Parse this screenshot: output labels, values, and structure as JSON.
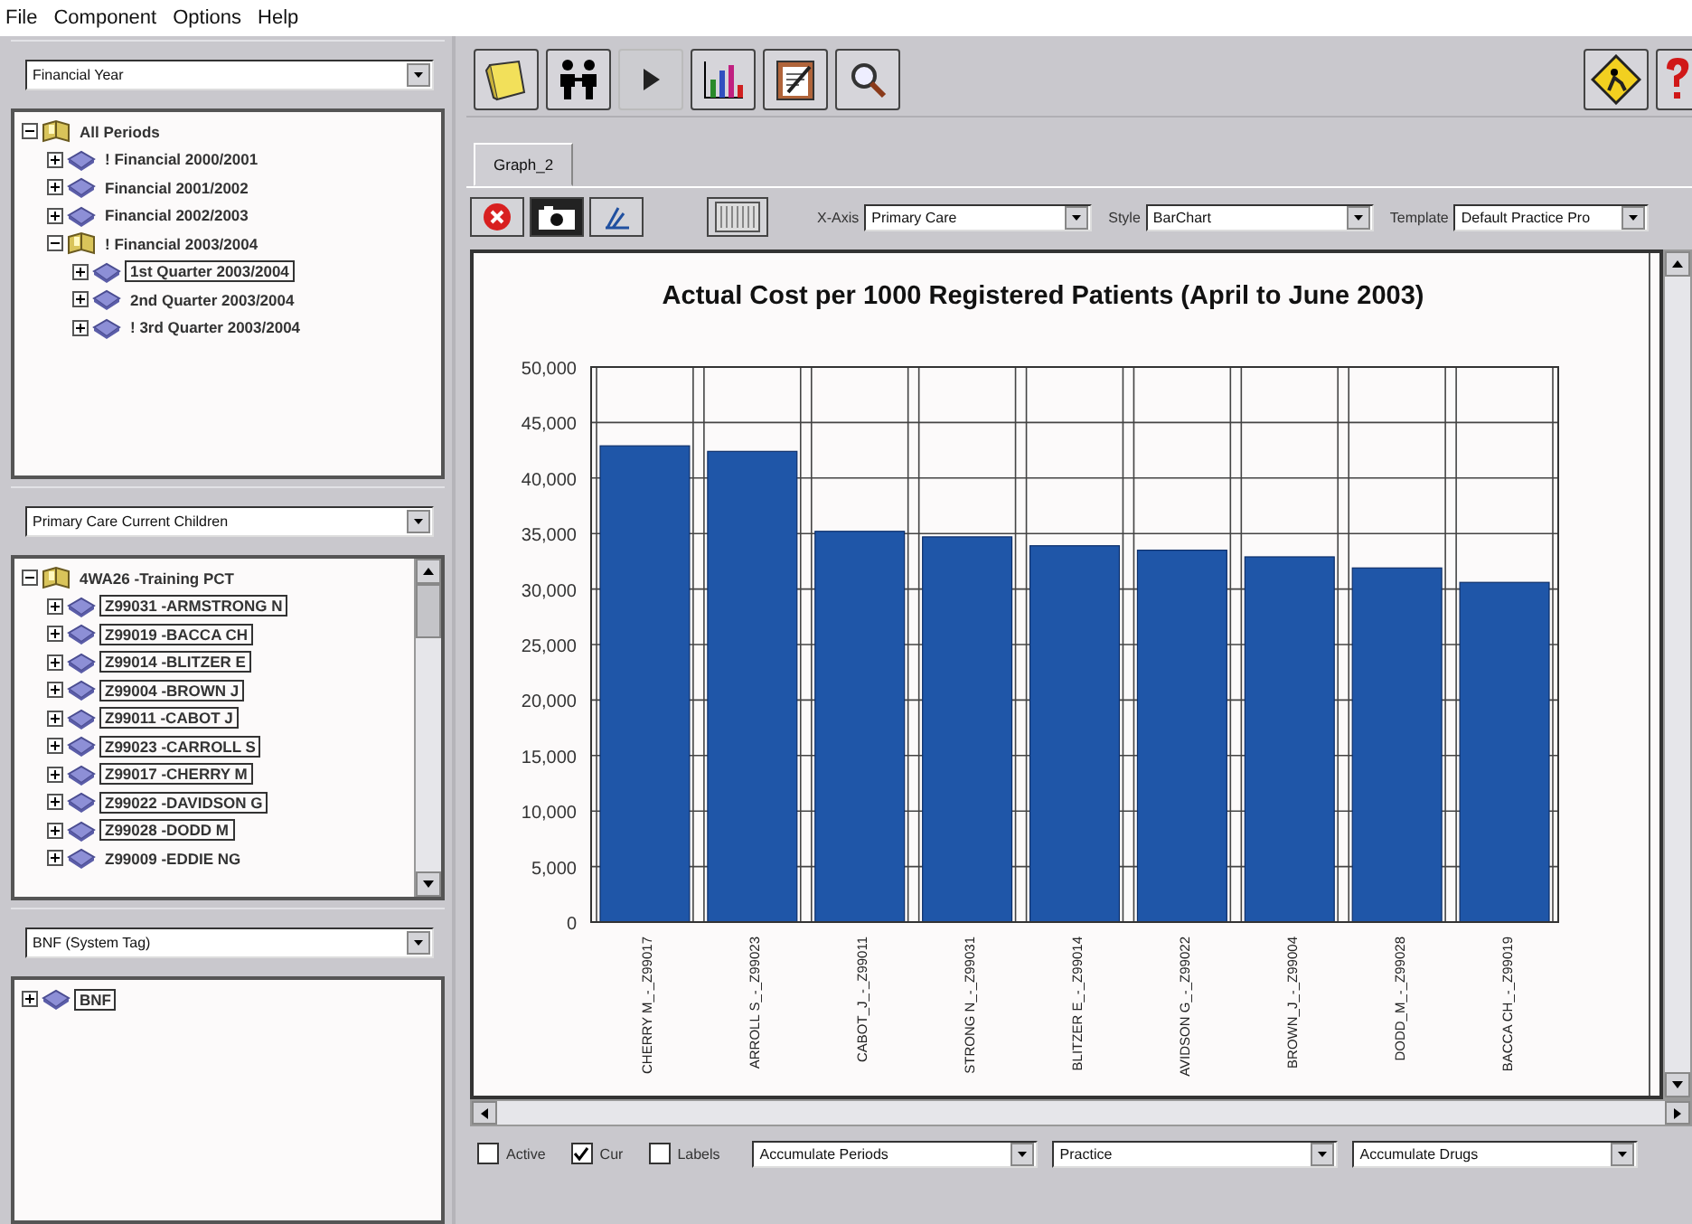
{
  "menu": [
    "File",
    "Component",
    "Options",
    "Help"
  ],
  "panels": [
    {
      "selector": "Financial Year",
      "scrollbar": false,
      "tree": [
        {
          "label": "All Periods",
          "expanded": true,
          "selected": false,
          "children": [
            {
              "label": "! Financial 2000/2001",
              "expanded": false,
              "selected": false
            },
            {
              "label": "Financial 2001/2002",
              "expanded": false,
              "selected": false
            },
            {
              "label": "Financial 2002/2003",
              "expanded": false,
              "selected": false
            },
            {
              "label": "! Financial 2003/2004",
              "expanded": true,
              "selected": false,
              "children": [
                {
                  "label": "1st Quarter 2003/2004",
                  "expanded": false,
                  "selected": true
                },
                {
                  "label": "2nd Quarter 2003/2004",
                  "expanded": false,
                  "selected": false
                },
                {
                  "label": "! 3rd Quarter 2003/2004",
                  "expanded": false,
                  "selected": false
                }
              ]
            }
          ]
        }
      ]
    },
    {
      "selector": "Primary Care Current Children",
      "scrollbar": true,
      "tree": [
        {
          "label": "4WA26 -Training PCT",
          "expanded": true,
          "selected": false,
          "children": [
            {
              "label": "Z99031 -ARMSTRONG N",
              "expanded": false,
              "selected": true
            },
            {
              "label": "Z99019 -BACCA CH",
              "expanded": false,
              "selected": true
            },
            {
              "label": "Z99014 -BLITZER E",
              "expanded": false,
              "selected": true
            },
            {
              "label": "Z99004 -BROWN J",
              "expanded": false,
              "selected": true
            },
            {
              "label": "Z99011 -CABOT J",
              "expanded": false,
              "selected": true
            },
            {
              "label": "Z99023 -CARROLL S",
              "expanded": false,
              "selected": true
            },
            {
              "label": "Z99017 -CHERRY M",
              "expanded": false,
              "selected": true
            },
            {
              "label": "Z99022 -DAVIDSON G",
              "expanded": false,
              "selected": true
            },
            {
              "label": "Z99028 -DODD M",
              "expanded": false,
              "selected": true
            },
            {
              "label": "Z99009 -EDDIE NG",
              "expanded": false,
              "selected": false
            }
          ]
        }
      ]
    },
    {
      "selector": "BNF (System Tag)",
      "scrollbar": false,
      "tree": [
        {
          "label": "BNF",
          "expanded": false,
          "selected": true
        }
      ]
    }
  ],
  "tabs": [
    {
      "label": "Graph_2",
      "selected": true
    }
  ],
  "graph_toolbar": {
    "x_axis_label": "X-Axis",
    "x_axis": "Primary Care",
    "style_label": "Style",
    "style": "BarChart",
    "template_label": "Template",
    "template": "Default Practice Pro"
  },
  "chart_data": {
    "type": "bar",
    "title": "Actual Cost per 1000 Registered Patients (April to June 2003)",
    "categories": [
      "CHERRY M_-_Z99017",
      "ARROLL S_-_Z99023",
      "CABOT_J_-_Z99011",
      "STRONG N_-_Z99031",
      "BLITZER E_-_Z99014",
      "AVIDSON G_-_Z99022",
      "BROWN_J_-_Z99004",
      "DODD_M_-_Z99028",
      "BACCA CH_-_Z99019"
    ],
    "series": [
      {
        "color": "#1f56a8",
        "values": [
          42900,
          42400,
          35200,
          34700,
          33900,
          33500,
          32900,
          31900,
          30600
        ]
      }
    ],
    "grid": true,
    "ylim": [
      0,
      50000
    ],
    "yticks": [
      {
        "value": 0,
        "label": "0"
      },
      {
        "value": 5000,
        "label": "5,000"
      },
      {
        "value": 10000,
        "label": "10,000"
      },
      {
        "value": 15000,
        "label": "15,000"
      },
      {
        "value": 20000,
        "label": "20,000"
      },
      {
        "value": 25000,
        "label": "25,000"
      },
      {
        "value": 30000,
        "label": "30,000"
      },
      {
        "value": 35000,
        "label": "35,000"
      },
      {
        "value": 40000,
        "label": "40,000"
      },
      {
        "value": 45000,
        "label": "45,000"
      },
      {
        "value": 50000,
        "label": "50,000"
      }
    ]
  },
  "options": {
    "checkboxes": [
      {
        "label": "Active",
        "checked": false
      },
      {
        "label": "Cur",
        "checked": true
      },
      {
        "label": "Labels",
        "checked": false
      }
    ],
    "dropdowns": [
      "Accumulate Periods",
      "Practice",
      "Accumulate Drugs"
    ]
  }
}
